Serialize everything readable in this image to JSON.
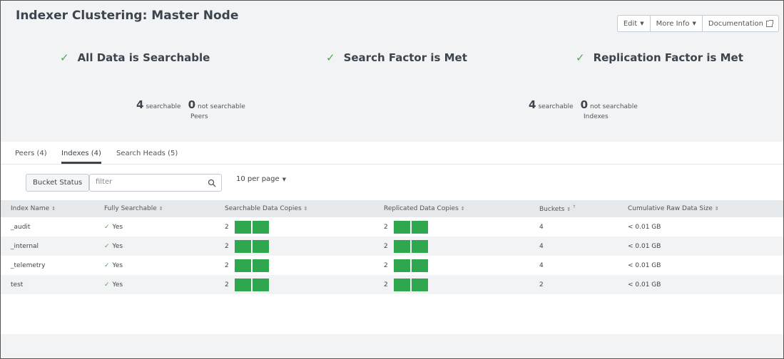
{
  "header": {
    "title": "Indexer Clustering: Master Node",
    "buttons": {
      "edit": "Edit",
      "more_info": "More Info",
      "documentation": "Documentation"
    }
  },
  "status": {
    "data_searchable": "All Data is Searchable",
    "search_factor": "Search Factor is Met",
    "replication_factor": "Replication Factor is Met"
  },
  "peers_summary": {
    "searchable_count": "4",
    "searchable_label": "searchable",
    "not_searchable_count": "0",
    "not_searchable_label": "not searchable",
    "label": "Peers"
  },
  "indexes_summary": {
    "searchable_count": "4",
    "searchable_label": "searchable",
    "not_searchable_count": "0",
    "not_searchable_label": "not searchable",
    "label": "Indexes"
  },
  "tabs": [
    {
      "label": "Peers (4)",
      "active": false
    },
    {
      "label": "Indexes (4)",
      "active": true
    },
    {
      "label": "Search Heads (5)",
      "active": false
    }
  ],
  "toolbar": {
    "bucket_status": "Bucket Status",
    "filter_placeholder": "filter",
    "per_page": "10 per page"
  },
  "table": {
    "columns": [
      "Index Name",
      "Fully Searchable",
      "Searchable Data Copies",
      "Replicated Data Copies",
      "Buckets",
      "Cumulative Raw Data Size"
    ],
    "rows": [
      {
        "name": "_audit",
        "fully_searchable": "Yes",
        "searchable_copies": "2",
        "replicated_copies": "2",
        "buckets": "4",
        "size": "< 0.01 GB"
      },
      {
        "name": "_internal",
        "fully_searchable": "Yes",
        "searchable_copies": "2",
        "replicated_copies": "2",
        "buckets": "4",
        "size": "< 0.01 GB"
      },
      {
        "name": "_telemetry",
        "fully_searchable": "Yes",
        "searchable_copies": "2",
        "replicated_copies": "2",
        "buckets": "4",
        "size": "< 0.01 GB"
      },
      {
        "name": "test",
        "fully_searchable": "Yes",
        "searchable_copies": "2",
        "replicated_copies": "2",
        "buckets": "2",
        "size": "< 0.01 GB"
      }
    ]
  },
  "colors": {
    "check_green": "#4aa74f",
    "copy_bar_green": "#2ea74f",
    "title": "#3c444d"
  }
}
